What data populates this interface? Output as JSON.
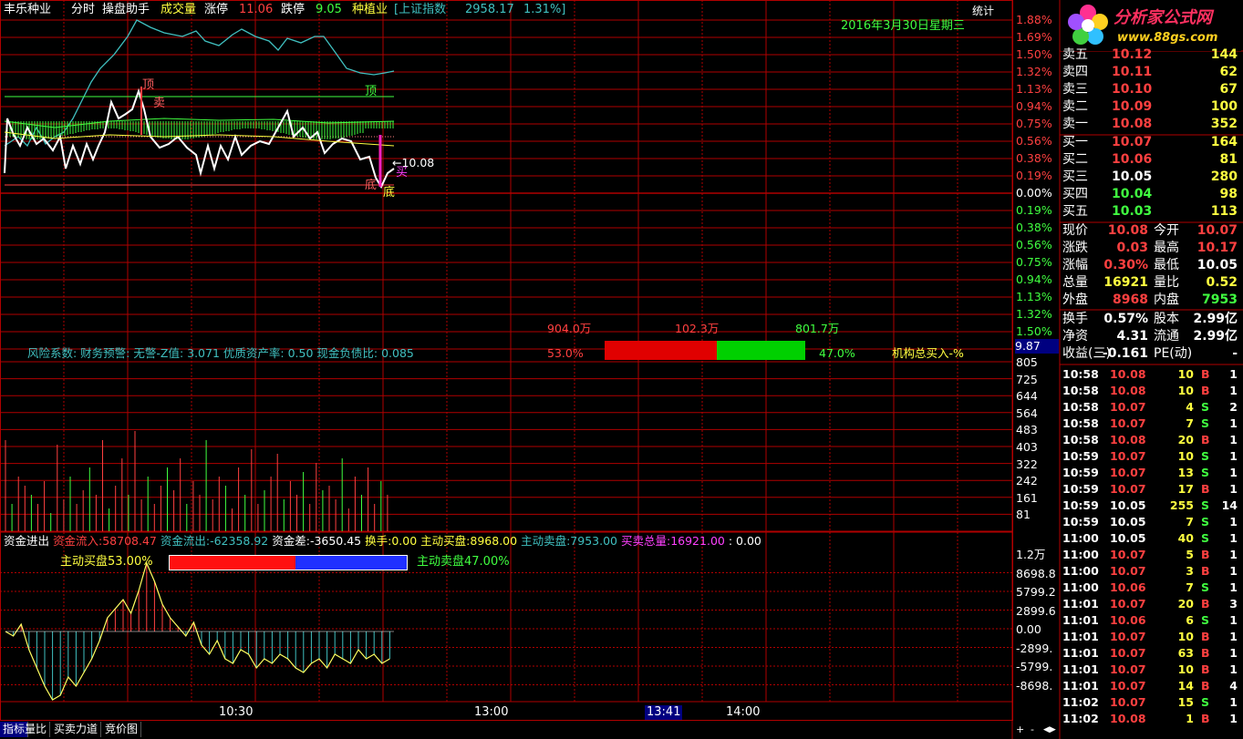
{
  "header": {
    "stock_name": "丰乐种业",
    "mode": "分时",
    "helper": "操盘助手",
    "volume_label": "成交量",
    "limit_up_label": "涨停",
    "limit_up_value": "11.06",
    "limit_down_label": "跌停",
    "limit_down_value": "9.05",
    "sector": "种植业",
    "index_name": "[上证指数",
    "index_value": "2958.17",
    "index_change": "1.31%]",
    "stats_button": "统计",
    "date": "2016年3月30日星期三"
  },
  "logo": {
    "name": "分析家公式网",
    "url": "www.88gs.com"
  },
  "price_scale_up": [
    "1.88%",
    "1.69%",
    "1.50%",
    "1.32%",
    "1.13%",
    "0.94%",
    "0.75%",
    "0.56%",
    "0.38%",
    "0.19%"
  ],
  "price_scale_zero": "0.00%",
  "price_scale_down": [
    "0.19%",
    "0.38%",
    "0.56%",
    "0.75%",
    "0.94%",
    "1.13%",
    "1.32%",
    "1.50%"
  ],
  "price_scale_bottom": "9.87",
  "annotations": {
    "top1": "顶",
    "sell": "卖",
    "top2": "顶",
    "bottom1": "底",
    "bottom2": "底",
    "buy": "买",
    "price_marker": "←10.08"
  },
  "flow_bar": {
    "left_amount": "904.0万",
    "mid_amount": "102.3万",
    "right_amount": "801.7万",
    "left_pct": "53.0%",
    "right_pct": "47.0%",
    "institution_label": "机构总买入-%"
  },
  "risk_line": "风险系数: 财务预警: 无警-Z值: 3.071 优质资产率: 0.50 现金负债比: 0.085",
  "volume_scale": [
    "805",
    "725",
    "644",
    "564",
    "483",
    "403",
    "322",
    "242",
    "161",
    "81"
  ],
  "fund_line": {
    "title": "资金进出",
    "inflow_label": "资金流入:",
    "inflow": "58708.47",
    "outflow_label": "资金流出:",
    "outflow": "-62358.92",
    "diff_label": "资金差:",
    "diff": "-3650.45",
    "turnover_label": "换手:",
    "turnover": "0.00",
    "active_buy_label": "主动买盘:",
    "active_buy": "8968.00",
    "active_sell_label": "主动卖盘:",
    "active_sell": "7953.00",
    "total_label": "买卖总量:",
    "total": "16921.00",
    "extra": ": 0.00"
  },
  "active_bar": {
    "buy_label": "主动买盘53.00%",
    "sell_label": "主动卖盘47.00%",
    "buy_pct": 53.0
  },
  "fund_scale": [
    "1.2万",
    "8698.8",
    "5799.2",
    "2899.6",
    "0.00",
    "-2899.",
    "-5799.",
    "-8698."
  ],
  "time_axis": [
    "10:30",
    "13:00",
    "13:41",
    "14:00"
  ],
  "bottom_tabs": [
    "指标",
    "量比",
    "买卖力道",
    "竞价图"
  ],
  "scroll_buttons": [
    "+",
    "-",
    "◀▶"
  ],
  "order_book": {
    "asks": [
      {
        "label": "卖五",
        "price": "10.12",
        "vol": "144"
      },
      {
        "label": "卖四",
        "price": "10.11",
        "vol": "62"
      },
      {
        "label": "卖三",
        "price": "10.10",
        "vol": "67"
      },
      {
        "label": "卖二",
        "price": "10.09",
        "vol": "100"
      },
      {
        "label": "卖一",
        "price": "10.08",
        "vol": "352"
      }
    ],
    "bids": [
      {
        "label": "买一",
        "price": "10.07",
        "vol": "164"
      },
      {
        "label": "买二",
        "price": "10.06",
        "vol": "81"
      },
      {
        "label": "买三",
        "price": "10.05",
        "vol": "280"
      },
      {
        "label": "买四",
        "price": "10.04",
        "vol": "98"
      },
      {
        "label": "买五",
        "price": "10.03",
        "vol": "113"
      }
    ]
  },
  "quote": {
    "rows": [
      {
        "l1": "现价",
        "v1": "10.08",
        "l2": "今开",
        "v2": "10.07",
        "c1": "red",
        "c2": "red"
      },
      {
        "l1": "涨跌",
        "v1": "0.03",
        "l2": "最高",
        "v2": "10.17",
        "c1": "red",
        "c2": "red"
      },
      {
        "l1": "涨幅",
        "v1": "0.30%",
        "l2": "最低",
        "v2": "10.05",
        "c1": "red",
        "c2": "white"
      },
      {
        "l1": "总量",
        "v1": "16921",
        "l2": "量比",
        "v2": "0.52",
        "c1": "yellow",
        "c2": "yellow"
      },
      {
        "l1": "外盘",
        "v1": "8968",
        "l2": "内盘",
        "v2": "7953",
        "c1": "red",
        "c2": "green"
      }
    ],
    "rows2": [
      {
        "l1": "换手",
        "v1": "0.57%",
        "l2": "股本",
        "v2": "2.99亿"
      },
      {
        "l1": "净资",
        "v1": "4.31",
        "l2": "流通",
        "v2": "2.99亿"
      },
      {
        "l1": "收益(三)",
        "v1": "-0.161",
        "l2": "PE(动)",
        "v2": "-"
      }
    ]
  },
  "ticks": [
    {
      "time": "10:58",
      "price": "10.08",
      "vol": "10",
      "side": "B",
      "n": "1",
      "pc": "red"
    },
    {
      "time": "10:58",
      "price": "10.08",
      "vol": "10",
      "side": "B",
      "n": "1",
      "pc": "red"
    },
    {
      "time": "10:58",
      "price": "10.07",
      "vol": "4",
      "side": "S",
      "n": "2",
      "pc": "red"
    },
    {
      "time": "10:58",
      "price": "10.07",
      "vol": "7",
      "side": "S",
      "n": "1",
      "pc": "red"
    },
    {
      "time": "10:58",
      "price": "10.08",
      "vol": "20",
      "side": "B",
      "n": "1",
      "pc": "red"
    },
    {
      "time": "10:59",
      "price": "10.07",
      "vol": "10",
      "side": "S",
      "n": "1",
      "pc": "red"
    },
    {
      "time": "10:59",
      "price": "10.07",
      "vol": "13",
      "side": "S",
      "n": "1",
      "pc": "red"
    },
    {
      "time": "10:59",
      "price": "10.07",
      "vol": "17",
      "side": "B",
      "n": "1",
      "pc": "red"
    },
    {
      "time": "10:59",
      "price": "10.05",
      "vol": "255",
      "side": "S",
      "n": "14",
      "pc": "white"
    },
    {
      "time": "10:59",
      "price": "10.05",
      "vol": "7",
      "side": "S",
      "n": "1",
      "pc": "white"
    },
    {
      "time": "11:00",
      "price": "10.05",
      "vol": "40",
      "side": "S",
      "n": "1",
      "pc": "white"
    },
    {
      "time": "11:00",
      "price": "10.07",
      "vol": "5",
      "side": "B",
      "n": "1",
      "pc": "red"
    },
    {
      "time": "11:00",
      "price": "10.07",
      "vol": "3",
      "side": "B",
      "n": "1",
      "pc": "red"
    },
    {
      "time": "11:00",
      "price": "10.06",
      "vol": "7",
      "side": "S",
      "n": "1",
      "pc": "red"
    },
    {
      "time": "11:01",
      "price": "10.07",
      "vol": "20",
      "side": "B",
      "n": "3",
      "pc": "red"
    },
    {
      "time": "11:01",
      "price": "10.06",
      "vol": "6",
      "side": "S",
      "n": "1",
      "pc": "red"
    },
    {
      "time": "11:01",
      "price": "10.07",
      "vol": "10",
      "side": "B",
      "n": "1",
      "pc": "red"
    },
    {
      "time": "11:01",
      "price": "10.07",
      "vol": "63",
      "side": "B",
      "n": "1",
      "pc": "red"
    },
    {
      "time": "11:01",
      "price": "10.07",
      "vol": "10",
      "side": "B",
      "n": "1",
      "pc": "red"
    },
    {
      "time": "11:01",
      "price": "10.07",
      "vol": "14",
      "side": "B",
      "n": "4",
      "pc": "red"
    },
    {
      "time": "11:02",
      "price": "10.07",
      "vol": "15",
      "side": "S",
      "n": "1",
      "pc": "red"
    },
    {
      "time": "11:02",
      "price": "10.08",
      "vol": "1",
      "side": "B",
      "n": "1",
      "pc": "red"
    }
  ],
  "colors": {
    "grid": "#b00000",
    "up": "#ff4040",
    "down": "#40ff40",
    "index_line": "#40c0c0",
    "price_line": "#ffffff"
  }
}
